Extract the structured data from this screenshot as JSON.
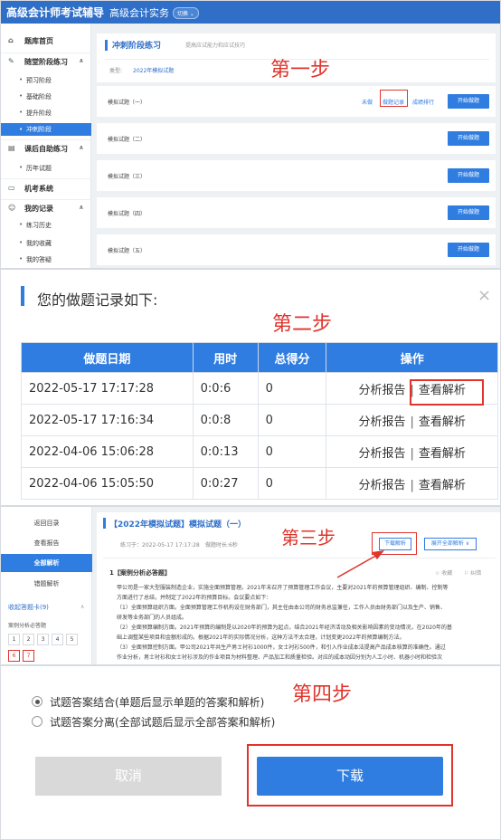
{
  "steps": [
    "第一步",
    "第二步",
    "第三步",
    "第四步"
  ],
  "panel1": {
    "brand": "高级会计师考试辅导",
    "subject": "高级会计实务",
    "switch_label": "切换 ⌄",
    "sidebar": {
      "question_bank_home": "题库首页",
      "practice_group": "随堂阶段练习",
      "practice_items": [
        "预习阶段",
        "基础阶段",
        "提升阶段",
        "冲刺阶段"
      ],
      "self_test_group": "课后自助练习",
      "self_test_items": [
        "历年试题"
      ],
      "mock_system": "机考系统",
      "records_group": "我的记录",
      "records_items": [
        "练习历史",
        "我的收藏",
        "我的答疑"
      ]
    },
    "section_title": "冲刺阶段练习",
    "section_tip": "提高应试能力和应试技巧",
    "type_label": "类型:",
    "type_value": "2022年模拟试题",
    "rows": [
      {
        "name": "模拟试题（一）",
        "button": "开始做题"
      },
      {
        "name": "模拟试题（二）",
        "button": "开始做题"
      },
      {
        "name": "模拟试题（三）",
        "button": "开始做题"
      },
      {
        "name": "模拟试题（四）",
        "button": "开始做题"
      },
      {
        "name": "模拟试题（五）",
        "button": "开始做题"
      }
    ],
    "row1_links": {
      "not_done": "未做",
      "record": "做题记录",
      "rank": "成绩排行"
    }
  },
  "panel2": {
    "title": "您的做题记录如下:",
    "close": "×",
    "headers": [
      "做题日期",
      "用时",
      "总得分",
      "操作"
    ],
    "records": [
      {
        "date": "2022-05-17 17:17:28",
        "time": "0:0:6",
        "score": "0"
      },
      {
        "date": "2022-05-17 17:16:34",
        "time": "0:0:8",
        "score": "0"
      },
      {
        "date": "2022-04-06 15:06:28",
        "time": "0:0:13",
        "score": "0"
      },
      {
        "date": "2022-04-06 15:05:50",
        "time": "0:0:27",
        "score": "0"
      }
    ],
    "report_label": "分析报告",
    "separator": "|",
    "analysis_label": "查看解析"
  },
  "panel3": {
    "sidebar": {
      "back": "返回目录",
      "report": "查看报告",
      "all_analysis": "全部解析",
      "wrong_analysis": "错题解析",
      "sheet": "收起答题卡(9)",
      "sheet_toggle": "∧",
      "category": "案例分析必答题",
      "numbers": [
        "1",
        "2",
        "3",
        "4",
        "5",
        "6",
        "7"
      ]
    },
    "title": "【2022年模拟试题】模拟试题（一）",
    "practice_time": "练习于：2022-05-17 17:17:28",
    "duration": "做题时长:6秒",
    "download_btn": "下载解析",
    "expand_btn": "展开全部解析 ∨",
    "question_type": "1【案例分析必答题】",
    "fav": "☆ 收藏",
    "err": "⚐ 纠错",
    "question_lines": [
      "甲公司是一家大型服装制造企业，实施全面预算管理。2021年末召开了预算管理工作会议，主要对2021年的预算管理组织、编制、控制等",
      "方面进行了总结，并制定了2022年的预算目标。会议要点如下：",
      "（1）全面预算组织方面。全面预算管理工作机构设在财务部门，其主任由本公司的财务总监兼任，工作人员由财务部门以及生产、销售、",
      "研发等业务部门的人员组成。",
      "（2）全面预算编制方面。2021年预算的编制是以2020年的预算为起点，结合2021年经济活动及相关影响因素的变动情况，在2020年的基",
      "础上调整某些项目和金额形成的。根据2021年的实际情况分析，这种方法不太合理，计划变更2022年的预算编制方法。",
      "（3）全面预算控制方面。甲公司2021年共生产男士衬衫1000件，女士衬衫500件，和引入作业成本法提高产品成本核算的准确性。通过",
      "作业分析，男士衬衫和女士衬衫涉及的作业项目为材料整理、产品加工和质量检验。对应的成本动因分别为人工小时、机器小时和检验次"
    ]
  },
  "panel4": {
    "option1": "试题答案结合(单题后显示单题的答案和解析)",
    "option2": "试题答案分离(全部试题后显示全部答案和解析)",
    "cancel": "取消",
    "download": "下载"
  }
}
